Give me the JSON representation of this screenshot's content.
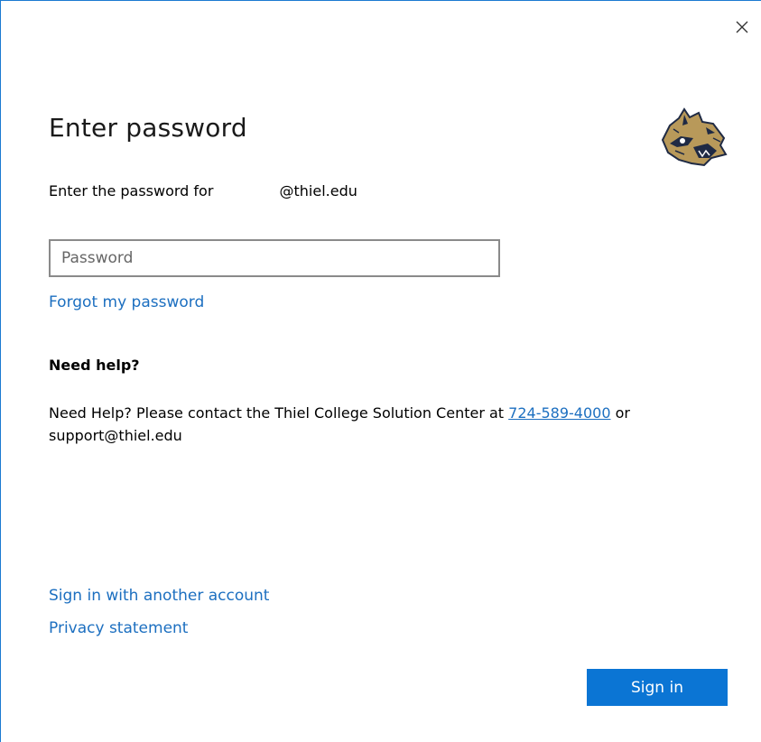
{
  "dialog": {
    "title": "Enter password",
    "instruction_prefix": "Enter the password for",
    "email_suffix": "@thiel.edu",
    "logo_icon": "bobcat-logo-icon",
    "close_icon": "close-icon"
  },
  "password": {
    "placeholder": "Password",
    "value": ""
  },
  "links": {
    "forgot": "Forgot my password",
    "other_account": "Sign in with another account",
    "privacy": "Privacy statement"
  },
  "help": {
    "heading": "Need help?",
    "text_before": "Need Help? Please contact the Thiel College Solution Center at ",
    "phone": "724-589-4000",
    "text_after": " or support@thiel.edu"
  },
  "actions": {
    "sign_in": "Sign in"
  },
  "colors": {
    "accent": "#0b75d4",
    "link": "#1c6fc0",
    "logo_gold": "#b8995a",
    "logo_navy": "#1f2a44"
  }
}
